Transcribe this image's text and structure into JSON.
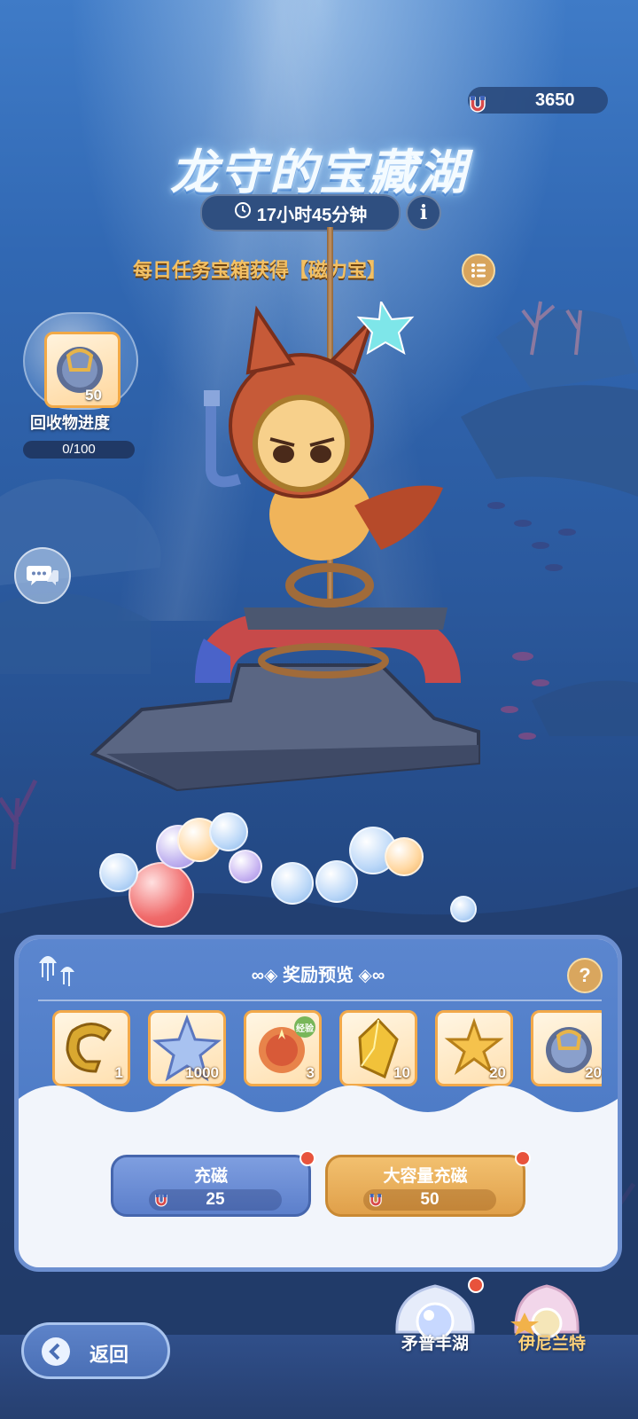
{
  "currency": {
    "amount": "3650",
    "icon": "magnet-icon"
  },
  "event": {
    "title": "龙守的宝藏湖",
    "timer": "17小时45分钟",
    "subtitle": "每日任务宝箱获得【磁力宝】"
  },
  "progress": {
    "item_count": "50",
    "label": "回收物进度",
    "value": "0/100",
    "fraction": 0
  },
  "panel": {
    "title": "奖励预览",
    "rewards": [
      {
        "name": "magnet",
        "count": "1"
      },
      {
        "name": "star-crystal",
        "count": "1000"
      },
      {
        "name": "exp-slime",
        "count": "3",
        "tag": "经验"
      },
      {
        "name": "gold-gem",
        "count": "10"
      },
      {
        "name": "gold-star",
        "count": "20"
      },
      {
        "name": "pearl-bubble",
        "count": "20"
      }
    ],
    "buttons": [
      {
        "label": "充磁",
        "cost": "25"
      },
      {
        "label": "大容量充磁",
        "cost": "50"
      }
    ]
  },
  "nav": {
    "back": "返回",
    "lakes": [
      "矛普丰湖",
      "伊尼兰特"
    ]
  },
  "colors": {
    "accent_gold": "#f3c063",
    "panel_blue": "#5b86cf",
    "alert_red": "#e8533c"
  }
}
